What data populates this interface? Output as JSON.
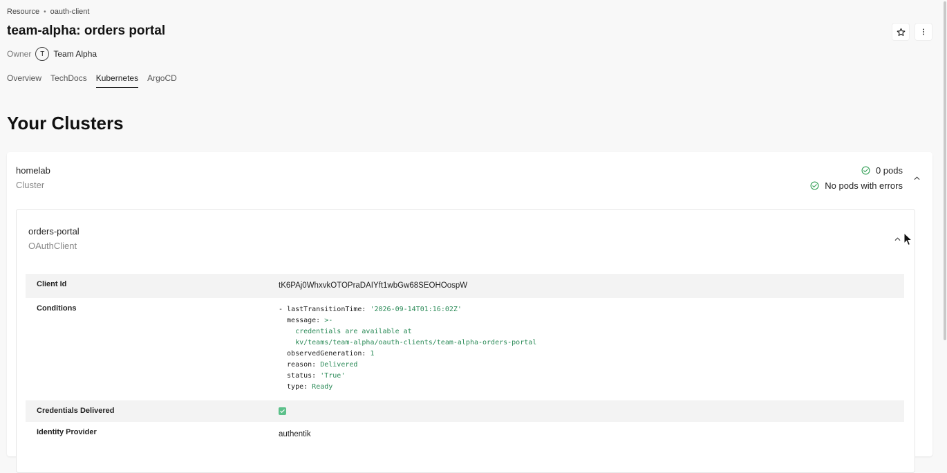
{
  "breadcrumb": {
    "parent": "Resource",
    "separator": "•",
    "current": "oauth-client"
  },
  "page": {
    "title": "team-alpha: orders portal"
  },
  "owner": {
    "label": "Owner",
    "avatar_initial": "T",
    "name": "Team Alpha"
  },
  "tabs": [
    {
      "label": "Overview",
      "active": false
    },
    {
      "label": "TechDocs",
      "active": false
    },
    {
      "label": "Kubernetes",
      "active": true
    },
    {
      "label": "ArgoCD",
      "active": false
    }
  ],
  "header_actions": {
    "star_icon": "star-outline-icon",
    "more_icon": "more-vert-icon"
  },
  "section": {
    "title": "Your Clusters"
  },
  "cluster": {
    "name": "homelab",
    "kind": "Cluster",
    "pods": "0 pods",
    "errors": "No pods with errors",
    "status_color": "#3aa35c"
  },
  "resource": {
    "name": "orders-portal",
    "kind": "OAuthClient",
    "client_id": {
      "label": "Client Id",
      "value": "tK6PAj0WhxvkOTOPraDAIYft1wbGw68SEOHOospW"
    },
    "conditions": {
      "label": "Conditions",
      "dash": "- ",
      "last_transition_key": "lastTransitionTime: ",
      "last_transition_value": "'2026-09-14T01:16:02Z'",
      "message_key": "  message: ",
      "message_indicator": ">-",
      "message_line1": "    credentials are available at",
      "message_line2": "    kv/teams/team-alpha/oauth-clients/team-alpha-orders-portal",
      "observed_key": "  observedGeneration: ",
      "observed_value": "1",
      "reason_key": "  reason: ",
      "reason_value": "Delivered",
      "status_key": "  status: ",
      "status_value": "'True'",
      "type_key": "  type: ",
      "type_value": "Ready"
    },
    "credentials_delivered": {
      "label": "Credentials Delivered",
      "checked": true
    },
    "identity_provider": {
      "label": "Identity Provider",
      "value": "authentik"
    }
  },
  "colors": {
    "accent_green": "#2a8a57",
    "check_green": "#5cc08a"
  }
}
